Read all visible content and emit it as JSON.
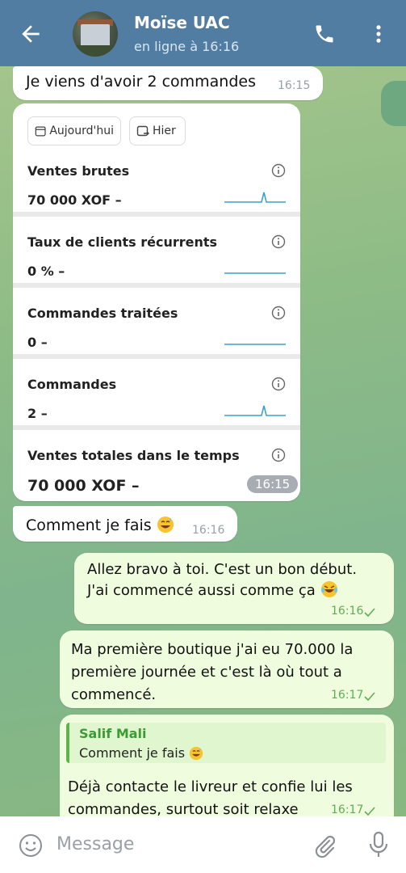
{
  "header": {
    "title": "Moïse UAC",
    "status": "en ligne à 16:16"
  },
  "messages": [
    {
      "text": "Je viens d'avoir 2 commandes",
      "time": "16:15"
    },
    {
      "text": "Comment je fais",
      "time": "16:16"
    },
    {
      "lines": [
        "Allez bravo à toi. C'est un bon début.",
        "J'ai commencé aussi comme ça"
      ],
      "time": "16:16"
    },
    {
      "lines": [
        "Ma première boutique j'ai eu 70.000 la",
        "première journée et c'est là où tout a",
        "commencé."
      ],
      "time": "16:17"
    },
    {
      "reply_name": "Salif Mali",
      "reply_text": "Comment je fais",
      "lines": [
        "Déjà contacte le livreur et confie lui les",
        "commandes, surtout soit relaxe"
      ],
      "time": "16:17"
    }
  ],
  "stats_card": {
    "chip_today": "Aujourd'hui",
    "chip_yesterday": "Hier",
    "rows": [
      {
        "label": "Ventes brutes",
        "value": "70 000 XOF –"
      },
      {
        "label": "Taux de clients récurrents",
        "value": "0 % –"
      },
      {
        "label": "Commandes traitées",
        "value": "0 –"
      },
      {
        "label": "Commandes",
        "value": "2 –"
      },
      {
        "label": "Ventes totales dans le temps",
        "value": "70 000 XOF –"
      }
    ],
    "time": "16:15"
  },
  "input": {
    "placeholder": "Message"
  },
  "colors": {
    "header": "#517da2",
    "outgoing": "#effdde",
    "accent": "#5fae57"
  }
}
